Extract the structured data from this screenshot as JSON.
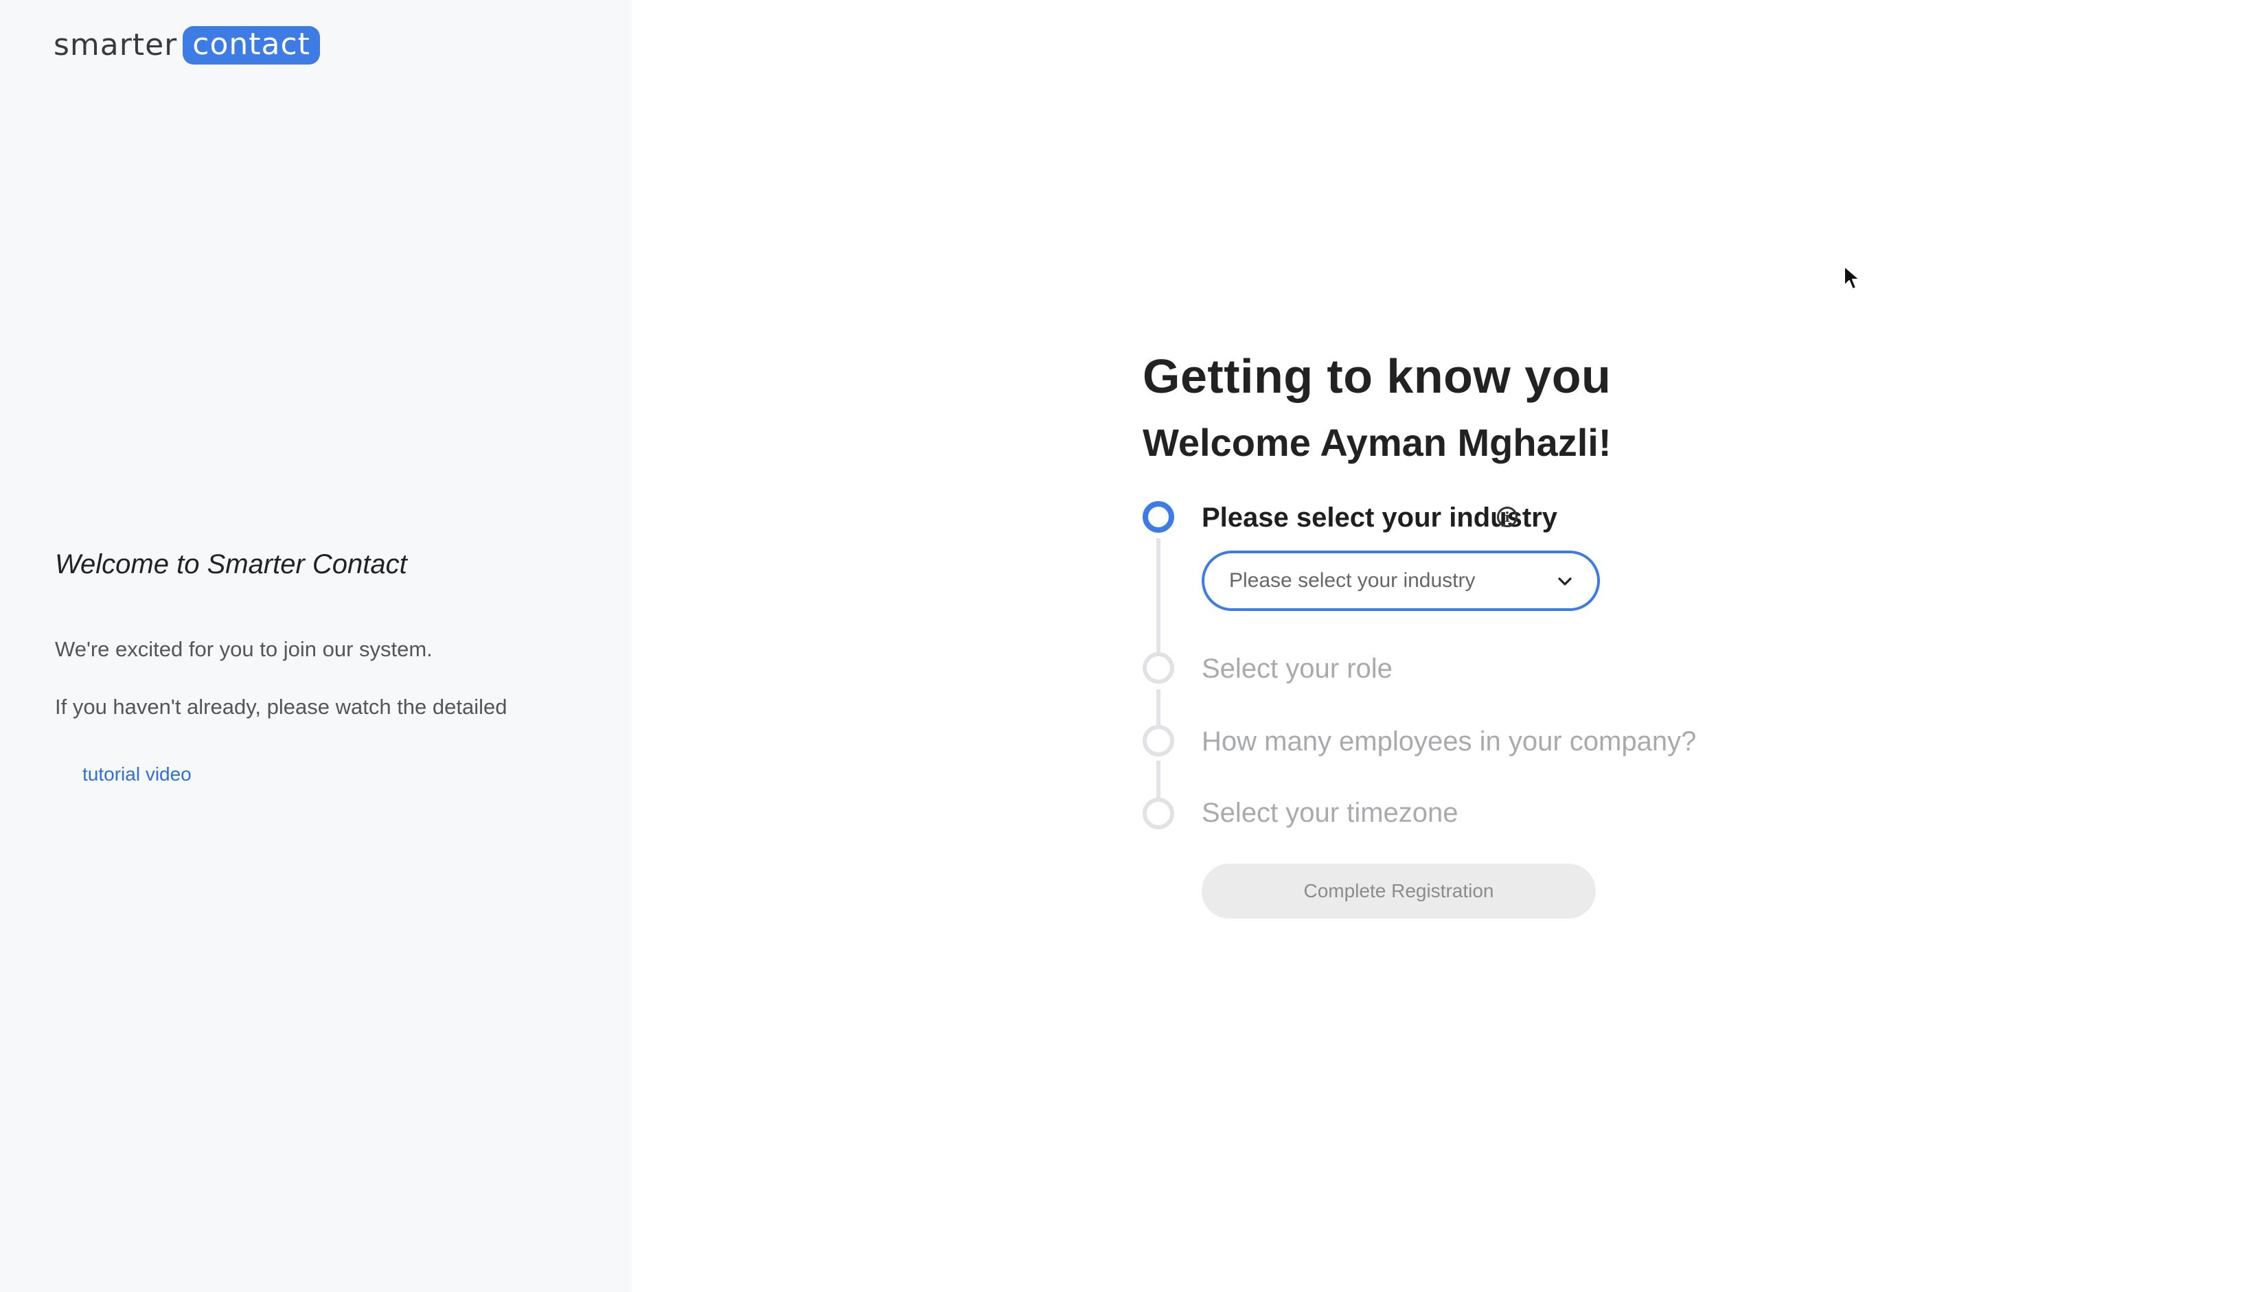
{
  "brand": {
    "logo_word": "smarter",
    "logo_pill": "contact",
    "accent_color": "#3d7be5"
  },
  "sidebar": {
    "title": "Welcome to Smarter Contact",
    "paragraph_1": "We're excited for you to join our system.",
    "paragraph_2": "If you haven't already, please watch the detailed",
    "link_label": "tutorial video"
  },
  "main": {
    "heading": "Getting to know you",
    "subheading": "Welcome Ayman Mghazli!",
    "steps": [
      {
        "label": "Please select your industry",
        "state": "active",
        "has_info_icon": true
      },
      {
        "label": "Select your role",
        "state": "pending"
      },
      {
        "label": "How many employees in your company?",
        "state": "pending"
      },
      {
        "label": "Select your timezone",
        "state": "pending"
      }
    ],
    "industry_select": {
      "placeholder": "Please select your industry",
      "icon": "chevron-down-icon"
    },
    "complete_button_label": "Complete Registration",
    "complete_button_state": "disabled"
  }
}
